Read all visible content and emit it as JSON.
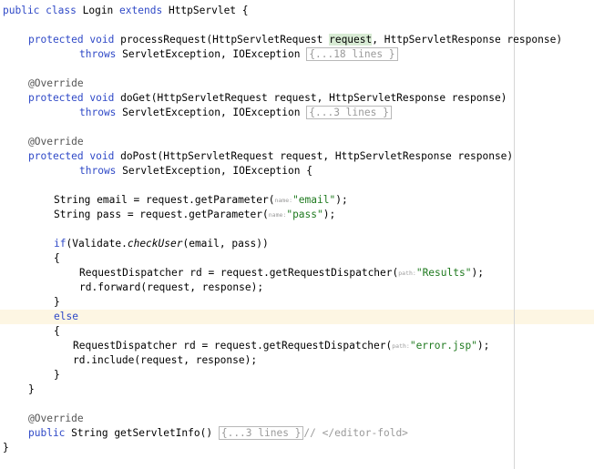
{
  "code": {
    "class_kw1": "public",
    "class_kw2": "class",
    "class_name": "Login",
    "class_kw3": "extends",
    "class_super": "HttpServlet {",
    "pr_kw1": "protected",
    "pr_kw2": "void",
    "pr_sig": "processRequest(HttpServletRequest ",
    "pr_req": "request",
    "pr_sig2": ", HttpServletResponse response)",
    "throws_kw": "throws",
    "throws_list": "ServletException, IOException",
    "throws_list_brace": "ServletException, IOException {",
    "fold_pr": "{...18 lines }",
    "override": "@Override",
    "doget_sig": "doGet(HttpServletRequest request, HttpServletResponse response)",
    "fold_doget": "{...3 lines }",
    "dopost_sig": "doPost(HttpServletRequest request, HttpServletResponse response)",
    "email_stmt": "String email = request.getParameter(",
    "hint_name": "name:",
    "str_email": "\"email\"",
    "stmt_end": ");",
    "pass_stmt": "String pass = request.getParameter(",
    "str_pass": "\"pass\"",
    "if_kw": "if",
    "if_pre": "(Validate.",
    "if_method": "checkUser",
    "if_post": "(email, pass))",
    "brace_open": "{",
    "brace_close": "}",
    "rd_stmt": "RequestDispatcher rd = request.getRequestDispatcher(",
    "hint_path": "path:",
    "str_results": "\"Results\"",
    "forward_stmt": "rd.forward(request, response);",
    "else_kw": "else",
    "str_error": "\"error.jsp\"",
    "include_stmt": "rd.include(request, response);",
    "public_kw": "public",
    "info_sig": "String getServletInfo()",
    "fold_info": "{...3 lines }",
    "editor_fold_comment": "// </editor-fold>"
  }
}
